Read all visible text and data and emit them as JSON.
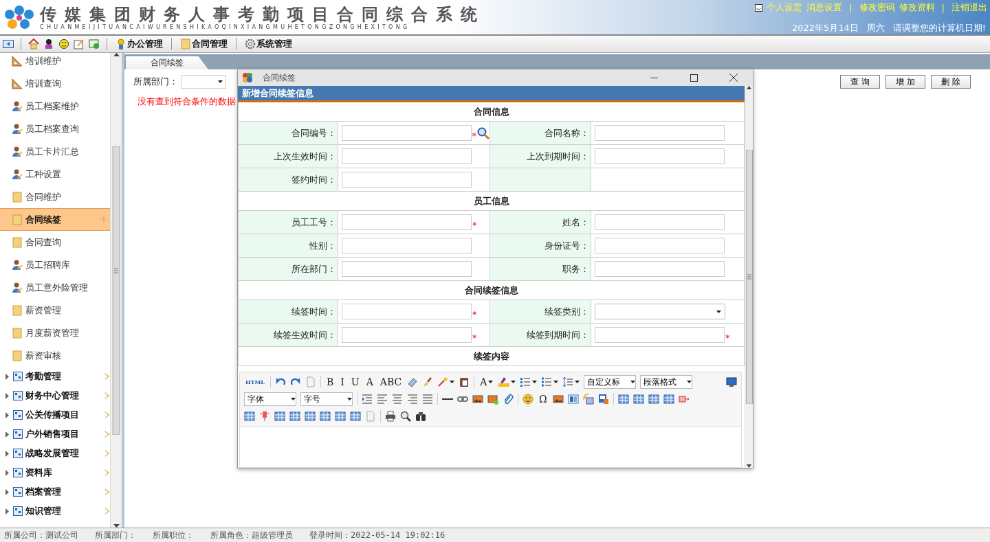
{
  "header": {
    "title": "传媒集团财务人事考勤项目合同综合系统",
    "subtitle": "CHUANMEIJITUANCAIWURENSHIKAOQINXIANGMUHETONGZONGHEXITONG",
    "links": [
      {
        "kind": "link",
        "text": "个人设定"
      },
      {
        "kind": "link",
        "text": "消息设置"
      },
      {
        "kind": "separator",
        "text": "|"
      },
      {
        "kind": "link",
        "text": "修改密码"
      },
      {
        "kind": "link",
        "text": "修改资料"
      },
      {
        "kind": "separator",
        "text": "|"
      },
      {
        "kind": "link",
        "text": "注销退出"
      }
    ],
    "date": "2022年5月14日",
    "weekday": "周六",
    "notice": "请调整您的计算机日期!"
  },
  "menu": [
    {
      "kind": "medal",
      "label": "办公管理"
    },
    {
      "kind": "folder",
      "label": "合同管理"
    },
    {
      "kind": "gear",
      "label": "系统管理"
    }
  ],
  "sidebar": {
    "items": [
      {
        "kind": "ruler",
        "label": "培训维护",
        "selected": false
      },
      {
        "kind": "ruler",
        "label": "培训查询",
        "selected": false
      },
      {
        "kind": "person",
        "label": "员工档案维护",
        "selected": false
      },
      {
        "kind": "person",
        "label": "员工档案查询",
        "selected": false
      },
      {
        "kind": "person",
        "label": "员工卡片汇总",
        "selected": false
      },
      {
        "kind": "person",
        "label": "工种设置",
        "selected": false
      },
      {
        "kind": "folder",
        "label": "合同维护",
        "selected": false
      },
      {
        "kind": "folder",
        "label": "合同续签",
        "selected": true
      },
      {
        "kind": "folder",
        "label": "合同查询",
        "selected": false
      },
      {
        "kind": "person",
        "label": "员工招聘库",
        "selected": false
      },
      {
        "kind": "person",
        "label": "员工意外险管理",
        "selected": false
      },
      {
        "kind": "folder",
        "label": "薪资管理",
        "selected": false
      },
      {
        "kind": "folder",
        "label": "月度薪资管理",
        "selected": false
      },
      {
        "kind": "folder",
        "label": "薪资审核",
        "selected": false
      }
    ],
    "groups": [
      {
        "label": "考勤管理",
        "expanded": false
      },
      {
        "label": "财务中心管理",
        "expanded": false
      },
      {
        "label": "公关传播项目",
        "expanded": false
      },
      {
        "label": "户外销售项目",
        "expanded": false
      },
      {
        "label": "战略发展管理",
        "expanded": false
      },
      {
        "label": "资料库",
        "expanded": false
      },
      {
        "label": "档案管理",
        "expanded": false
      },
      {
        "label": "知识管理",
        "expanded": false
      }
    ]
  },
  "tabs": [
    {
      "label": "合同续签",
      "selected": true
    }
  ],
  "filter": {
    "label": "所属部门：",
    "message": "没有查到符合条件的数据",
    "buttons": [
      "查 询",
      "增 加",
      "删 除"
    ]
  },
  "dialog": {
    "title": "合同续签",
    "heading": "新增合同续签信息",
    "sections": [
      {
        "title": "合同信息",
        "rows": [
          [
            {
              "label": "合同编号：",
              "kind": "search",
              "mark": "*"
            },
            {
              "label": "合同名称：",
              "kind": "text"
            }
          ],
          [
            {
              "label": "上次生效时间：",
              "kind": "text"
            },
            {
              "label": "上次到期时间：",
              "kind": "text"
            }
          ],
          [
            {
              "label": "签约时间：",
              "kind": "text"
            }
          ]
        ]
      },
      {
        "title": "员工信息",
        "rows": [
          [
            {
              "label": "员工工号：",
              "kind": "text",
              "mark": "*"
            },
            {
              "label": "姓名：",
              "kind": "text"
            }
          ],
          [
            {
              "label": "性别：",
              "kind": "text"
            },
            {
              "label": "身份证号：",
              "kind": "text"
            }
          ],
          [
            {
              "label": "所在部门：",
              "kind": "text"
            },
            {
              "label": "职务：",
              "kind": "text"
            }
          ]
        ]
      },
      {
        "title": "合同续签信息",
        "rows": [
          [
            {
              "label": "续签时间：",
              "kind": "text",
              "mark": "*"
            },
            {
              "label": "续签类别：",
              "kind": "select"
            }
          ],
          [
            {
              "label": "续签生效时间：",
              "kind": "text",
              "mark": "*"
            },
            {
              "label": "续签到期时间：",
              "kind": "text",
              "mark": "*"
            }
          ]
        ]
      },
      {
        "title": "续签内容"
      }
    ],
    "editor": {
      "rows": [
        [
          {
            "kind": "glyph",
            "text": "HTML"
          },
          {
            "kind": "sep"
          },
          {
            "kind": "undo"
          },
          {
            "kind": "redo"
          },
          {
            "kind": "page"
          },
          {
            "kind": "sep"
          },
          {
            "kind": "glyph",
            "text": "B"
          },
          {
            "kind": "glyph",
            "text": "I"
          },
          {
            "kind": "glyph",
            "text": "U"
          },
          {
            "kind": "glyph",
            "text": "A"
          },
          {
            "kind": "glyph",
            "text": "ABC"
          },
          {
            "kind": "eraser"
          },
          {
            "kind": "brush"
          },
          {
            "kind": "wand",
            "dropdown": true
          },
          {
            "kind": "paste"
          },
          {
            "kind": "sep"
          },
          {
            "kind": "glyph",
            "text": "A",
            "dropdown": true
          },
          {
            "kind": "highlight",
            "dropdown": true
          },
          {
            "kind": "numbered",
            "dropdown": true
          },
          {
            "kind": "bullets",
            "dropdown": true
          },
          {
            "kind": "spacing",
            "dropdown": true
          },
          {
            "kind": "select",
            "text": "自定义标"
          },
          {
            "kind": "select",
            "text": "段落格式"
          },
          {
            "kind": "monitor"
          }
        ],
        [
          {
            "kind": "select",
            "text": "字体"
          },
          {
            "kind": "select",
            "text": "字号"
          },
          {
            "kind": "sep"
          },
          {
            "kind": "indent"
          },
          {
            "kind": "left"
          },
          {
            "kind": "center"
          },
          {
            "kind": "right"
          },
          {
            "kind": "justify"
          },
          {
            "kind": "sep"
          },
          {
            "kind": "rule"
          },
          {
            "kind": "link"
          },
          {
            "kind": "image"
          },
          {
            "kind": "gallery"
          },
          {
            "kind": "clip"
          },
          {
            "kind": "sep"
          },
          {
            "kind": "smiley"
          },
          {
            "kind": "glyph",
            "text": "Ω"
          },
          {
            "kind": "image"
          },
          {
            "kind": "layout"
          },
          {
            "kind": "video"
          },
          {
            "kind": "word"
          },
          {
            "kind": "sep"
          },
          {
            "kind": "table"
          },
          {
            "kind": "table"
          },
          {
            "kind": "table"
          },
          {
            "kind": "table"
          },
          {
            "kind": "split"
          }
        ],
        [
          {
            "kind": "table"
          },
          {
            "kind": "pin"
          },
          {
            "kind": "table"
          },
          {
            "kind": "table"
          },
          {
            "kind": "table"
          },
          {
            "kind": "table"
          },
          {
            "kind": "table"
          },
          {
            "kind": "table"
          },
          {
            "kind": "page"
          },
          {
            "kind": "sep"
          },
          {
            "kind": "print"
          },
          {
            "kind": "preview"
          },
          {
            "kind": "binoculars"
          }
        ]
      ]
    }
  },
  "status_bar": [
    "所属公司：测试公司",
    "所属部门：",
    "所属职位：",
    "所属角色：超级管理员",
    "登录时间：2022-05-14 19:02:16"
  ]
}
